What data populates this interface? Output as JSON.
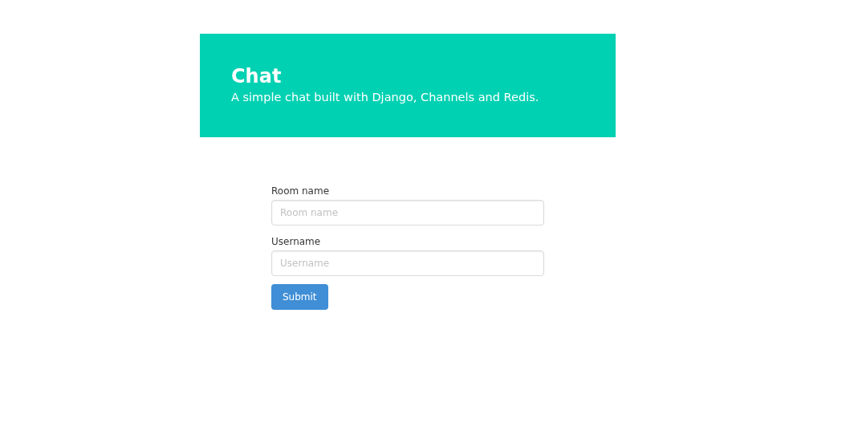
{
  "hero": {
    "title": "Chat",
    "subtitle": "A simple chat built with Django, Channels and Redis."
  },
  "form": {
    "fields": [
      {
        "label": "Room name",
        "placeholder": "Room name"
      },
      {
        "label": "Username",
        "placeholder": "Username"
      }
    ],
    "submit": "Submit"
  }
}
